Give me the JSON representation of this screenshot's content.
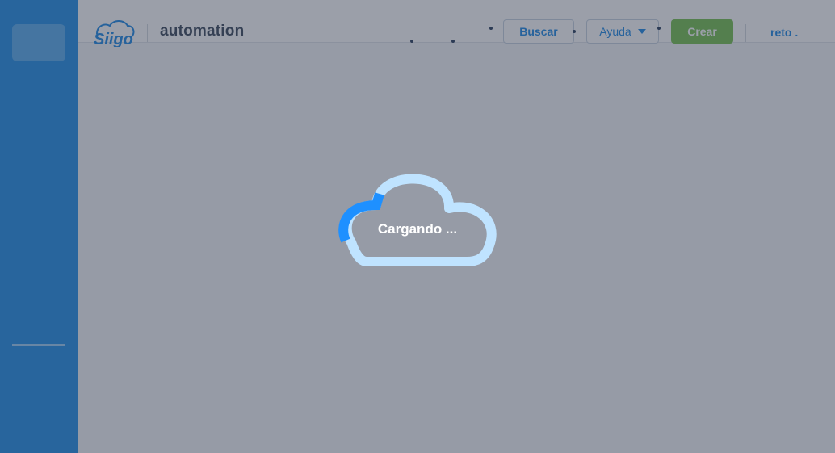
{
  "header": {
    "company_name": "automation",
    "search_label": "Buscar",
    "help_label": "Ayuda",
    "create_label": "Crear",
    "user_label": "reto ."
  },
  "loader": {
    "text": "Cargando ..."
  },
  "icons": {
    "brand": "siigo-cloud-logo",
    "help_caret": "chevron-down-icon",
    "loader": "cloud-spinner-icon"
  },
  "colors": {
    "sidebar": "#2391e8",
    "accent": "#1f8ae6",
    "create": "#77c251",
    "loader_track": "#bfe3ff",
    "loader_progress": "#1e90ff"
  }
}
